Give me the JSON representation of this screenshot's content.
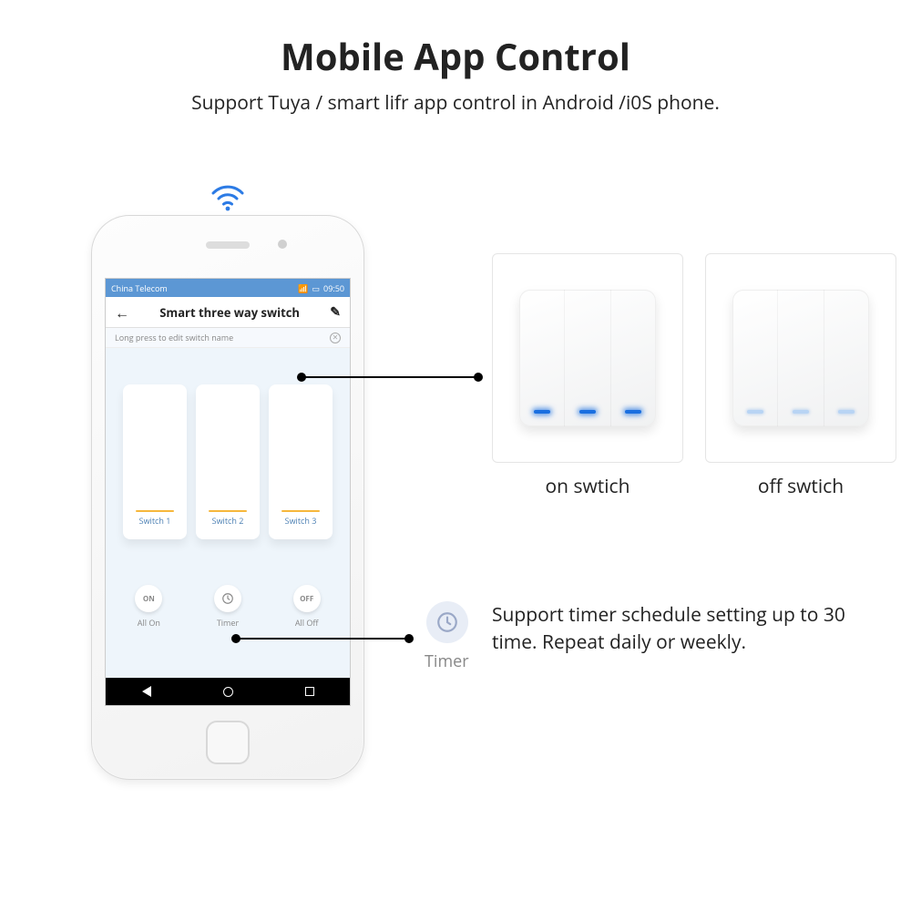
{
  "title": "Mobile App Control",
  "subtitle": "Support Tuya / smart lifr app control in Android /i0S phone.",
  "phone": {
    "status_left": "China Telecom",
    "status_time": "09:50",
    "app_title": "Smart three way switch",
    "hint": "Long press to edit switch name",
    "switches": [
      "Switch 1",
      "Switch 2",
      "Switch 3"
    ],
    "bottom": {
      "all_on_btn": "ON",
      "all_on_label": "All On",
      "timer_label": "Timer",
      "all_off_btn": "OFF",
      "all_off_label": "All Off"
    }
  },
  "products": {
    "on_caption": "on swtich",
    "off_caption": "off swtich"
  },
  "timer": {
    "label": "Timer",
    "desc": "Support timer schedule setting up to 30 time. Repeat daily or weekly."
  }
}
